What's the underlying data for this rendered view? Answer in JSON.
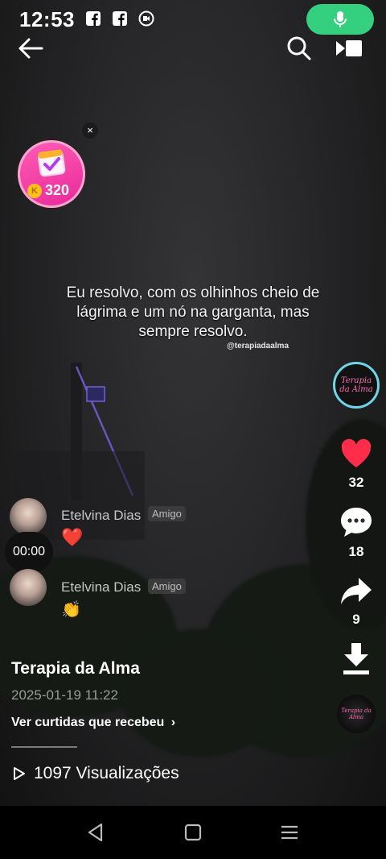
{
  "status_bar": {
    "time": "12:53"
  },
  "badge": {
    "coins": "320",
    "coin_letter": "K",
    "close": "×"
  },
  "video": {
    "caption": "Eu resolvo, com os olhinhos cheio de lágrima e um nó na garganta, mas sempre resolvo.",
    "handle": "@terapiadaalma"
  },
  "rail": {
    "avatar_text": "Terapia da Alma",
    "likes": "32",
    "comments": "18",
    "shares": "9"
  },
  "comments": [
    {
      "name": "Etelvina Dias",
      "tag": "Amigo",
      "reaction": "❤️"
    },
    {
      "name": "Etelvina Dias",
      "tag": "Amigo",
      "reaction": "👏"
    }
  ],
  "timer": "00:00",
  "post": {
    "title": "Terapia da Alma",
    "date": "2025-01-19 11:22",
    "likes_link": "Ver curtidas que recebeu",
    "views": "1097 Visualizações"
  },
  "colors": {
    "mic": "#35d07f",
    "heart": "#ff2d4a",
    "badge": "#e8289a"
  }
}
